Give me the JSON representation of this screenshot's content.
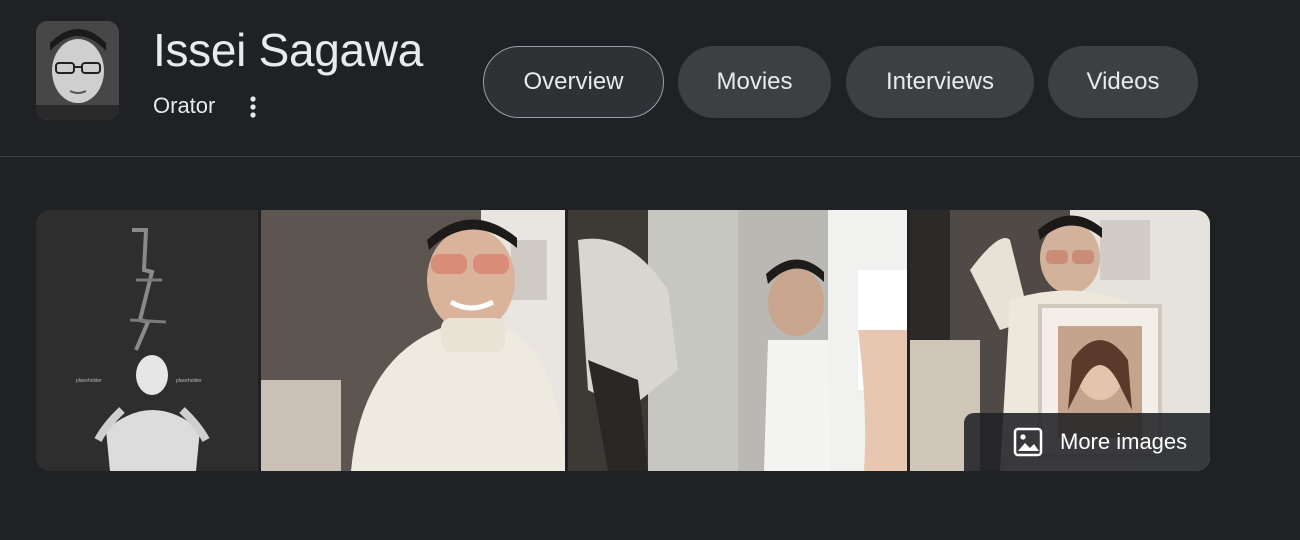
{
  "entity": {
    "name": "Issei Sagawa",
    "description": "Orator"
  },
  "icons": {
    "avatar": "portrait-photo",
    "more": "vertical-ellipsis-icon",
    "more_images": "image-icon"
  },
  "tabs": [
    {
      "label": "Overview",
      "active": true
    },
    {
      "label": "Movies",
      "active": false
    },
    {
      "label": "Interviews",
      "active": false
    },
    {
      "label": "Videos",
      "active": false
    }
  ],
  "gallery": {
    "tile_count": 4,
    "more_label": "More images"
  },
  "colors": {
    "background": "#202124",
    "chip": "#3c4043",
    "chip_active_border": "#9aa0a6",
    "text": "#e8eaed"
  }
}
